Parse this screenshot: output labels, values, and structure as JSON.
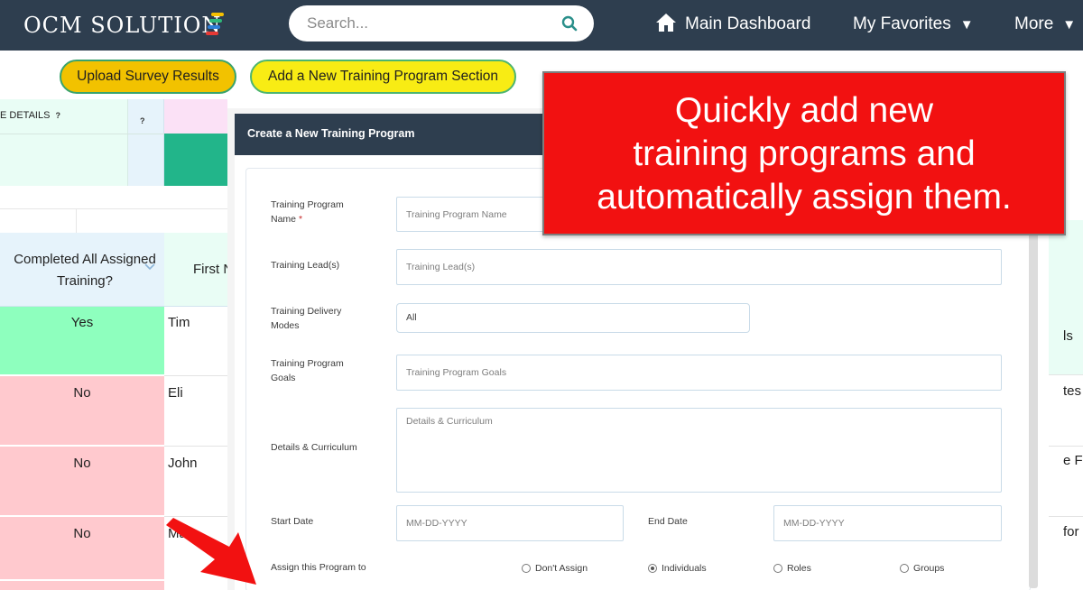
{
  "header": {
    "logo_text": "OCM SOLUTION",
    "search_placeholder": "Search...",
    "nav": {
      "home": "Main Dashboard",
      "favorites": "My Favorites",
      "more": "More",
      "caret": "▼"
    }
  },
  "actions": {
    "upload": "Upload Survey Results",
    "add_section": "Add a New Training Program Section"
  },
  "table": {
    "details_header": "E DETAILS",
    "help_badge": "?",
    "completed_header": "Completed All Assigned Training?",
    "first_header": "First N",
    "rows": [
      {
        "completed": "Yes",
        "first": "Tim",
        "edge": "ls"
      },
      {
        "completed": "No",
        "first": "Eli",
        "edge": "tes"
      },
      {
        "completed": "No",
        "first": "John",
        "edge": "e F"
      },
      {
        "completed": "No",
        "first": "Ma",
        "edge": "for"
      }
    ]
  },
  "modal": {
    "title": "Create a New Training Program",
    "fields": {
      "name_label": "Training Program Name",
      "required_mark": "*",
      "name_placeholder": "Training Program Name",
      "lead_label": "Training Lead(s)",
      "lead_placeholder": "Training Lead(s)",
      "delivery_label": "Training Delivery Modes",
      "delivery_value": "All",
      "goals_label": "Training Program Goals",
      "goals_placeholder": "Training Program Goals",
      "details_label": "Details & Curriculum",
      "details_placeholder": "Details & Curriculum",
      "start_label": "Start Date",
      "start_placeholder": "MM-DD-YYYY",
      "end_label": "End Date",
      "end_placeholder": "MM-DD-YYYY",
      "assign_label": "Assign this Program to"
    },
    "assign_options": [
      {
        "label": "Don't Assign",
        "selected": false
      },
      {
        "label": "Individuals",
        "selected": true
      },
      {
        "label": "Roles",
        "selected": false
      },
      {
        "label": "Groups",
        "selected": false
      }
    ]
  },
  "callout": {
    "line1": "Quickly add new",
    "line2": "training programs and",
    "line3": "automatically assign them."
  },
  "colors": {
    "navy": "#2e3e4f",
    "yes_green": "#8effbe",
    "no_pink": "#ffc9ce",
    "callout_red": "#f21111",
    "button_gold": "#f2c200",
    "button_yellow": "#f8ec14"
  },
  "icons": {
    "search": "search-icon",
    "home": "home-icon",
    "arrow": "red-arrow-icon"
  }
}
